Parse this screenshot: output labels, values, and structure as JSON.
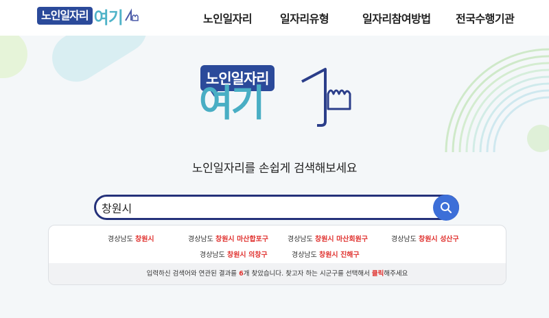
{
  "header": {
    "logo_badge": "노인일자리",
    "logo_word": "여기",
    "nav": [
      "노인일자리",
      "일자리유형",
      "일자리참여방법",
      "전국수행기관"
    ]
  },
  "hero": {
    "logo_badge": "노인일자리",
    "logo_word": "여기",
    "tagline": "노인일자리를 손쉽게 검색해보세요"
  },
  "search": {
    "value": "창원시",
    "button_icon": "search-icon"
  },
  "results": [
    {
      "region": "경상남도",
      "match": "창원시"
    },
    {
      "region": "경상남도",
      "match": "창원시 마산합포구"
    },
    {
      "region": "경상남도",
      "match": "창원시 마산회원구"
    },
    {
      "region": "경상남도",
      "match": "창원시 성산구"
    },
    {
      "region": "경상남도",
      "match": "창원시 의창구"
    },
    {
      "region": "경상남도",
      "match": "창원시 진해구"
    }
  ],
  "note": {
    "prefix": "입력하신 검색어와 연관된 결과를 ",
    "count": "6",
    "middle": "개 찾았습니다. 찾고자 하는 시군구를 선택해서 ",
    "click": "클릭",
    "suffix": "해주세요"
  },
  "colors": {
    "brand_navy": "#2b4a9a",
    "brand_teal": "#49aec4",
    "search_border": "#24317a",
    "search_button": "#3d6fd8",
    "highlight": "#e0322f"
  }
}
